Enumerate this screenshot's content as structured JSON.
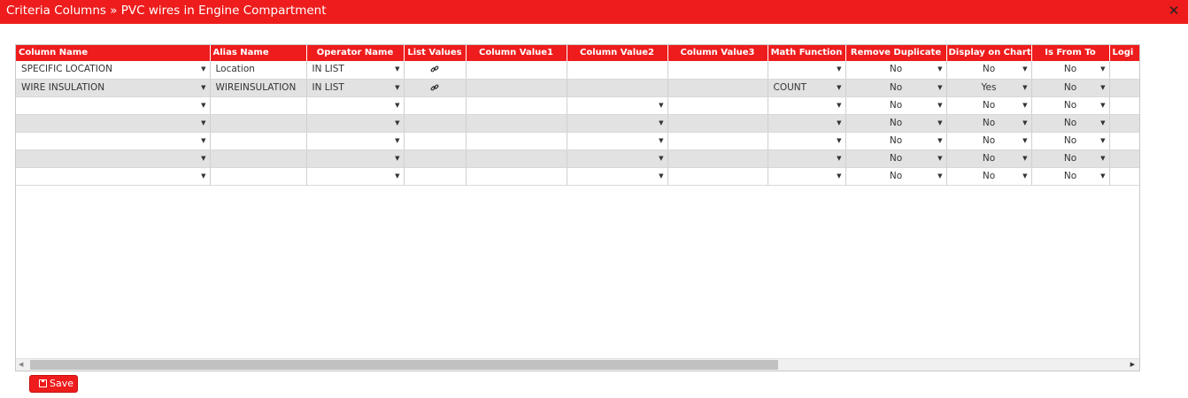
{
  "header": {
    "title": "Criteria Columns » PVC wires in Engine Compartment",
    "close_glyph": "✕"
  },
  "grid": {
    "columns": [
      "Column Name",
      "Alias Name",
      "Operator Name",
      "List Values",
      "Column Value1",
      "Column Value2",
      "Column Value3",
      "Math Function",
      "Remove Duplicate",
      "Display on Chart",
      "Is From To",
      "Logi"
    ],
    "rows": [
      {
        "column_name": "SPECIFIC LOCATION",
        "alias": "Location",
        "operator": "IN LIST",
        "math": "",
        "remove_dup": "No",
        "display": "No",
        "is_from_to": "No"
      },
      {
        "column_name": "WIRE INSULATION",
        "alias": "WIREINSULATION",
        "operator": "IN LIST",
        "math": "COUNT",
        "remove_dup": "No",
        "display": "Yes",
        "is_from_to": "No"
      },
      {
        "column_name": "",
        "alias": "",
        "operator": "",
        "math": "",
        "remove_dup": "No",
        "display": "No",
        "is_from_to": "No"
      },
      {
        "column_name": "",
        "alias": "",
        "operator": "",
        "math": "",
        "remove_dup": "No",
        "display": "No",
        "is_from_to": "No"
      },
      {
        "column_name": "",
        "alias": "",
        "operator": "",
        "math": "",
        "remove_dup": "No",
        "display": "No",
        "is_from_to": "No"
      },
      {
        "column_name": "",
        "alias": "",
        "operator": "",
        "math": "",
        "remove_dup": "No",
        "display": "No",
        "is_from_to": "No"
      },
      {
        "column_name": "",
        "alias": "",
        "operator": "",
        "math": "",
        "remove_dup": "No",
        "display": "No",
        "is_from_to": "No"
      }
    ]
  },
  "footer": {
    "save_label": "Save",
    "save_icon": "save-icon"
  },
  "colors": {
    "accent": "#ee1c1c",
    "row_alt": "#e2e2e2"
  }
}
